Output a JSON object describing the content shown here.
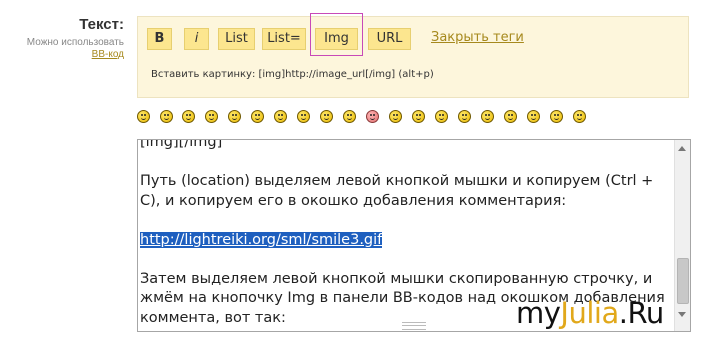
{
  "form": {
    "label": "Текст:",
    "sublabel": "Можно использовать",
    "bbcode_link": "BB-код"
  },
  "toolbar": {
    "buttons": [
      {
        "label": "B"
      },
      {
        "label": "i"
      },
      {
        "label": "List"
      },
      {
        "label": "List="
      },
      {
        "label": "Img"
      },
      {
        "label": "URL"
      }
    ],
    "close_tags_link": "Закрыть теги",
    "hint": "Вставить картинку: [img]http://image_url[/img]  (alt+p)"
  },
  "smileys": [
    "smile-icon",
    "grin-icon",
    "laugh-icon",
    "sad-icon",
    "confused-icon",
    "wink-icon",
    "cool-icon",
    "tongue-icon",
    "cry-icon",
    "biggrin-icon",
    "blush-icon",
    "dizzy-icon",
    "angry-icon",
    "devil-icon",
    "eek-icon",
    "rolleyes-icon",
    "exclamation-icon",
    "question-icon",
    "idea-icon",
    "arrow-icon"
  ],
  "editor": {
    "line0": "[img][/img]",
    "para1": "Путь (location) выделяем левой кнопкой мышки и копируем (Ctrl + C), и копируем его в окошко добавления комментария:",
    "url": "http://lightreiki.org/sml/smile3.gif",
    "para2": "Затем выделяем левой кнопкой мышки скопированную строчку, и жмём на кнопочку Img в панели BB-кодов над окошком добавления коммента, вот так:"
  },
  "watermark": {
    "part1": "my",
    "part2": "Julia",
    "part3": ".Ru"
  }
}
